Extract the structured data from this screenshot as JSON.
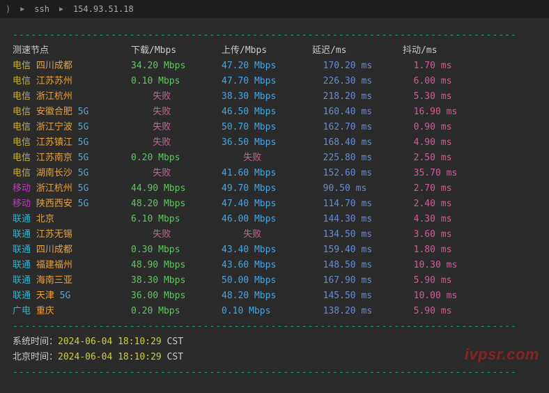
{
  "titlebar": {
    "paren": ")",
    "arrow1": "▶",
    "ssh": "ssh",
    "arrow2": "▶",
    "ip": "154.93.51.18"
  },
  "dividerLine": "----------------------------------------------------------------------------------",
  "headers": {
    "node": "测速节点",
    "down": "下载/Mbps",
    "up": "上传/Mbps",
    "latency": "延迟/ms",
    "jitter": "抖动/ms"
  },
  "rows": [
    {
      "ispClass": "isp-ct",
      "isp": "电信",
      "loc": "四川成都",
      "g5": "",
      "down": "34.20 Mbps",
      "up": "47.20 Mbps",
      "lat": "170.20 ms",
      "jit": "1.70 ms",
      "downFail": false,
      "upFail": false
    },
    {
      "ispClass": "isp-ct",
      "isp": "电信",
      "loc": "江苏苏州",
      "g5": "",
      "down": "0.10 Mbps",
      "up": "47.70 Mbps",
      "lat": "226.30 ms",
      "jit": "6.00 ms",
      "downFail": false,
      "upFail": false
    },
    {
      "ispClass": "isp-ct",
      "isp": "电信",
      "loc": "浙江杭州",
      "g5": "",
      "down": "失败",
      "up": "38.30 Mbps",
      "lat": "218.20 ms",
      "jit": "5.30 ms",
      "downFail": true,
      "upFail": false
    },
    {
      "ispClass": "isp-ct",
      "isp": "电信",
      "loc": "安徽合肥",
      "g5": "5G",
      "down": "失败",
      "up": "46.50 Mbps",
      "lat": "160.40 ms",
      "jit": "16.90 ms",
      "downFail": true,
      "upFail": false
    },
    {
      "ispClass": "isp-ct",
      "isp": "电信",
      "loc": "浙江宁波",
      "g5": "5G",
      "down": "失败",
      "up": "50.70 Mbps",
      "lat": "162.70 ms",
      "jit": "0.90 ms",
      "downFail": true,
      "upFail": false
    },
    {
      "ispClass": "isp-ct",
      "isp": "电信",
      "loc": "江苏镇江",
      "g5": "5G",
      "down": "失败",
      "up": "36.50 Mbps",
      "lat": "168.40 ms",
      "jit": "4.90 ms",
      "downFail": true,
      "upFail": false
    },
    {
      "ispClass": "isp-ct",
      "isp": "电信",
      "loc": "江苏南京",
      "g5": "5G",
      "down": "0.20 Mbps",
      "up": "失败",
      "lat": "225.80 ms",
      "jit": "2.50 ms",
      "downFail": false,
      "upFail": true
    },
    {
      "ispClass": "isp-ct",
      "isp": "电信",
      "loc": "湖南长沙",
      "g5": "5G",
      "down": "失败",
      "up": "41.60 Mbps",
      "lat": "152.60 ms",
      "jit": "35.70 ms",
      "downFail": true,
      "upFail": false
    },
    {
      "ispClass": "isp-cm",
      "isp": "移动",
      "loc": "浙江杭州",
      "g5": "5G",
      "down": "44.90 Mbps",
      "up": "49.70 Mbps",
      "lat": "90.50 ms",
      "jit": "2.70 ms",
      "downFail": false,
      "upFail": false
    },
    {
      "ispClass": "isp-cm",
      "isp": "移动",
      "loc": "陕西西安",
      "g5": "5G",
      "down": "48.20 Mbps",
      "up": "47.40 Mbps",
      "lat": "114.70 ms",
      "jit": "2.40 ms",
      "downFail": false,
      "upFail": false
    },
    {
      "ispClass": "isp-cu",
      "isp": "联通",
      "loc": "北京",
      "g5": "",
      "down": "6.10 Mbps",
      "up": "46.00 Mbps",
      "lat": "144.30 ms",
      "jit": "4.30 ms",
      "downFail": false,
      "upFail": false
    },
    {
      "ispClass": "isp-cu",
      "isp": "联通",
      "loc": "江苏无锡",
      "g5": "",
      "down": "失败",
      "up": "失败",
      "lat": "134.50 ms",
      "jit": "3.60 ms",
      "downFail": true,
      "upFail": true
    },
    {
      "ispClass": "isp-cu",
      "isp": "联通",
      "loc": "四川成都",
      "g5": "",
      "down": "0.30 Mbps",
      "up": "43.40 Mbps",
      "lat": "159.40 ms",
      "jit": "1.80 ms",
      "downFail": false,
      "upFail": false
    },
    {
      "ispClass": "isp-cu",
      "isp": "联通",
      "loc": "福建福州",
      "g5": "",
      "down": "48.90 Mbps",
      "up": "43.60 Mbps",
      "lat": "148.50 ms",
      "jit": "10.30 ms",
      "downFail": false,
      "upFail": false
    },
    {
      "ispClass": "isp-cu",
      "isp": "联通",
      "loc": "海南三亚",
      "g5": "",
      "down": "38.30 Mbps",
      "up": "50.00 Mbps",
      "lat": "167.90 ms",
      "jit": "5.90 ms",
      "downFail": false,
      "upFail": false
    },
    {
      "ispClass": "isp-cu",
      "isp": "联通",
      "loc": "天津",
      "g5": "5G",
      "down": "36.00 Mbps",
      "up": "48.20 Mbps",
      "lat": "145.50 ms",
      "jit": "10.00 ms",
      "downFail": false,
      "upFail": false
    },
    {
      "ispClass": "isp-gd",
      "isp": "广电",
      "loc": "重庆",
      "g5": "",
      "down": "0.20 Mbps",
      "up": "0.10 Mbps",
      "lat": "138.20 ms",
      "jit": "5.90 ms",
      "downFail": false,
      "upFail": false
    }
  ],
  "systime": {
    "label": "系统时间：",
    "value": "2024-06-04 18:10:29",
    "tz": " CST"
  },
  "bjtime": {
    "label": "北京时间：",
    "value": "2024-06-04 18:10:29",
    "tz": " CST"
  },
  "watermark": "ivpsr.com"
}
